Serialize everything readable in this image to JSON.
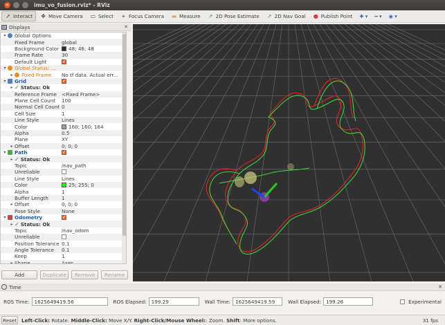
{
  "window": {
    "title": "imu_vo_fusion.rviz* - RViz"
  },
  "toolbar": {
    "tools": [
      {
        "label": "Interact",
        "icon": "interact-icon",
        "active": true
      },
      {
        "label": "Move Camera",
        "icon": "move-camera-icon"
      },
      {
        "label": "Select",
        "icon": "select-icon"
      },
      {
        "label": "Focus Camera",
        "icon": "focus-camera-icon"
      },
      {
        "label": "Measure",
        "icon": "measure-icon"
      },
      {
        "label": "2D Pose Estimate",
        "icon": "pose-estimate-icon"
      },
      {
        "label": "2D Nav Goal",
        "icon": "nav-goal-icon"
      },
      {
        "label": "Publish Point",
        "icon": "publish-point-icon"
      }
    ]
  },
  "displays": {
    "title": "Displays",
    "rows": [
      {
        "indent": 0,
        "exp": "▾",
        "icon": "globe",
        "name": "Global Options",
        "value": ""
      },
      {
        "indent": 1,
        "name": "Fixed Frame",
        "value": "global"
      },
      {
        "indent": 1,
        "name": "Background Color",
        "value": "48; 48; 48",
        "swatch": "#303030"
      },
      {
        "indent": 1,
        "name": "Frame Rate",
        "value": "30"
      },
      {
        "indent": 1,
        "name": "Default Light",
        "checkbox": true
      },
      {
        "indent": 0,
        "exp": "▾",
        "icon": "warn",
        "name": "Global Status: ...",
        "cls": "orange",
        "value": ""
      },
      {
        "indent": 1,
        "exp": "▸",
        "icon": "warn",
        "name": "Fixed Frame",
        "cls": "orange",
        "value": "No tf data.  Actual err..."
      },
      {
        "indent": 0,
        "exp": "▾",
        "icon": "grid",
        "name": "Grid",
        "cls": "blue",
        "checkbox": true
      },
      {
        "indent": 1,
        "exp": "▸",
        "check": true,
        "name": "Status: Ok",
        "value": ""
      },
      {
        "indent": 1,
        "name": "Reference Frame",
        "value": "<Fixed Frame>"
      },
      {
        "indent": 1,
        "name": "Plane Cell Count",
        "value": "100"
      },
      {
        "indent": 1,
        "name": "Normal Cell Count",
        "value": "0"
      },
      {
        "indent": 1,
        "name": "Cell Size",
        "value": "1"
      },
      {
        "indent": 1,
        "name": "Line Style",
        "value": "Lines"
      },
      {
        "indent": 1,
        "name": "Color",
        "value": "160; 160; 164",
        "swatch": "#a0a0a4"
      },
      {
        "indent": 1,
        "name": "Alpha",
        "value": "0.5"
      },
      {
        "indent": 1,
        "name": "Plane",
        "value": "XY"
      },
      {
        "indent": 1,
        "exp": "▸",
        "name": "Offset",
        "value": "0; 0; 0"
      },
      {
        "indent": 0,
        "exp": "▾",
        "icon": "path",
        "name": "Path",
        "cls": "blue",
        "checkbox": true
      },
      {
        "indent": 1,
        "exp": "▸",
        "check": true,
        "name": "Status: Ok",
        "value": ""
      },
      {
        "indent": 1,
        "name": "Topic",
        "value": "/nav_path"
      },
      {
        "indent": 1,
        "name": "Unreliable",
        "checkbox": false
      },
      {
        "indent": 1,
        "name": "Line Style",
        "value": "Lines"
      },
      {
        "indent": 1,
        "name": "Color",
        "value": "25; 255; 0",
        "swatch": "#19ff00"
      },
      {
        "indent": 1,
        "name": "Alpha",
        "value": "1"
      },
      {
        "indent": 1,
        "name": "Buffer Length",
        "value": "1"
      },
      {
        "indent": 1,
        "exp": "▸",
        "name": "Offset",
        "value": "0; 0; 0"
      },
      {
        "indent": 1,
        "name": "Pose Style",
        "value": "None"
      },
      {
        "indent": 0,
        "exp": "▾",
        "icon": "odom",
        "name": "Odometry",
        "cls": "blue",
        "checkbox": true
      },
      {
        "indent": 1,
        "exp": "▸",
        "check": true,
        "name": "Status: Ok",
        "value": ""
      },
      {
        "indent": 1,
        "name": "Topic",
        "value": "/nav_odom"
      },
      {
        "indent": 1,
        "name": "Unreliable",
        "checkbox": false
      },
      {
        "indent": 1,
        "name": "Position Tolerance",
        "value": "0.1"
      },
      {
        "indent": 1,
        "name": "Angle Tolerance",
        "value": "0.1"
      },
      {
        "indent": 1,
        "name": "Keep",
        "value": "1"
      },
      {
        "indent": 1,
        "exp": "▸",
        "name": "Shape",
        "value": "Axes"
      }
    ],
    "buttons": {
      "add": "Add",
      "duplicate": "Duplicate",
      "remove": "Remove",
      "rename": "Rename"
    }
  },
  "time": {
    "title": "Time",
    "ros_time_label": "ROS Time:",
    "ros_time": "1625649419.56",
    "ros_elapsed_label": "ROS Elapsed:",
    "ros_elapsed": "199.29",
    "wall_time_label": "Wall Time:",
    "wall_time": "1625649419.59",
    "wall_elapsed_label": "Wall Elapsed:",
    "wall_elapsed": "199.26",
    "experimental_label": "Experimental"
  },
  "status": {
    "reset_label": "Reset",
    "hint_b1": "Left-Click:",
    "hint_t1": " Rotate. ",
    "hint_b2": "Middle-Click:",
    "hint_t2": " Move X/Y. ",
    "hint_b3": "Right-Click/Mouse Wheel:",
    "hint_t3": ": Zoom. ",
    "hint_b4": "Shift",
    "hint_t4": ": More options.",
    "fps": "31 fps"
  },
  "colors": {
    "background": "#303030",
    "grid": "#a0a0a4",
    "path": "#19ff00",
    "odom": "#ff2020"
  }
}
